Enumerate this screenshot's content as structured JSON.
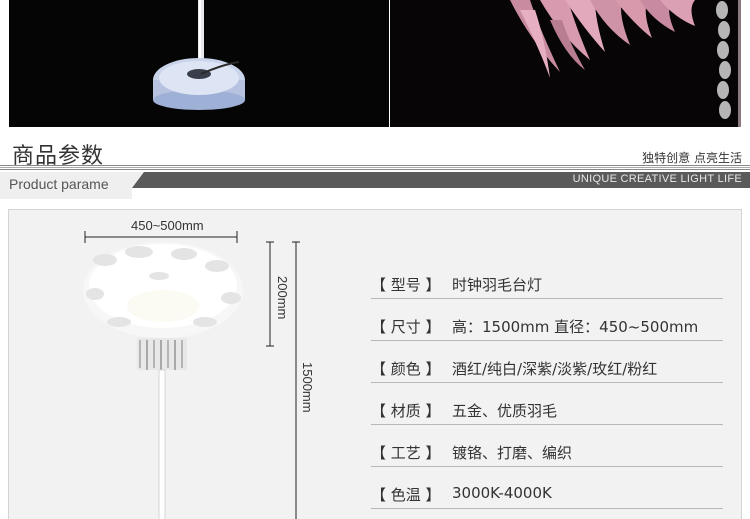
{
  "header": {
    "title": "商品参数",
    "slogan": "独特创意 点亮生活",
    "band_label": "Product parame",
    "band_slogan": "UNIQUE CREATIVE LIGHT LIFE"
  },
  "dimensions": {
    "width": "450~500mm",
    "shade_height": "200mm",
    "total_height": "1500mm"
  },
  "params": [
    {
      "label": "【 型号 】",
      "value": "时钟羽毛台灯"
    },
    {
      "label": "【 尺寸 】",
      "value": "高：1500mm  直径：450~500mm"
    },
    {
      "label": "【 颜色 】",
      "value": "酒红/纯白/深紫/淡紫/玫红/粉红"
    },
    {
      "label": "【 材质 】",
      "value": "五金、优质羽毛"
    },
    {
      "label": "【 工艺 】",
      "value": "镀铬、打磨、编织"
    },
    {
      "label": "【 色温 】",
      "value": "3000K-4000K"
    }
  ],
  "colors": {
    "band": "#5a5a5a",
    "panel": "#f2f2f2",
    "feather_pink": "#d89aae"
  }
}
